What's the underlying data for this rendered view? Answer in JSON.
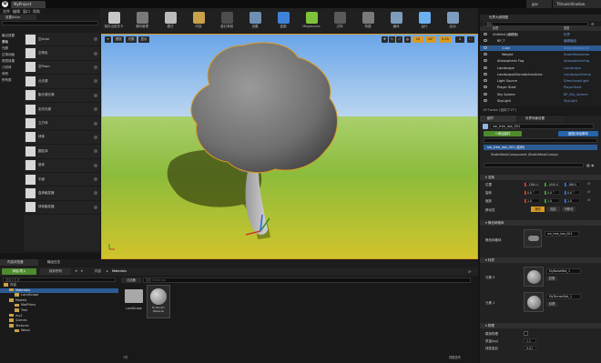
{
  "window": {
    "tab": "MyProject",
    "right_tabs": [
      "gac",
      "TitlewinShadow"
    ]
  },
  "menu": [
    "文件",
    "编辑",
    "窗口",
    "帮助"
  ],
  "toolbar": {
    "items": [
      {
        "label": "保存当前关卡",
        "color": "#c8c8c8",
        "icon": "save-icon"
      },
      {
        "label": "源码管理",
        "color": "#7a7a7a",
        "icon": "source-control-icon"
      },
      {
        "label": "模式",
        "color": "#bbbbbb",
        "icon": "modes-icon"
      },
      {
        "label": "内容",
        "color": "#c9a24a",
        "icon": "content-icon"
      },
      {
        "label": "虚幻商城",
        "color": "#4d4d4d",
        "icon": "marketplace-icon"
      },
      {
        "label": "设置",
        "color": "#6f8fb5",
        "icon": "settings-icon"
      },
      {
        "label": "蓝图",
        "color": "#3e83d9",
        "icon": "blueprints-icon"
      },
      {
        "label": "Megascans",
        "color": "#7ec43a",
        "icon": "megascans-icon"
      },
      {
        "label": "过场",
        "color": "#5a5a5a",
        "icon": "cinematics-icon"
      },
      {
        "label": "构建",
        "color": "#7a7a7a",
        "icon": "build-icon"
      },
      {
        "label": "编译",
        "color": "#7e9cbd",
        "icon": "compile-icon"
      },
      {
        "label": "运行",
        "color": "#6bb0f0",
        "icon": "play-icon"
      },
      {
        "label": "启动",
        "color": "#7e9cbd",
        "icon": "launch-icon"
      }
    ]
  },
  "modes_panel": {
    "tab": "放置Actor",
    "search_placeholder": "搜索类",
    "categories": [
      "最近放置",
      "基础",
      "光照",
      "过场动画",
      "视觉效果",
      "几何体",
      "体积",
      "所有类"
    ],
    "items": [
      "空Actor",
      "空角色",
      "空Pawn",
      "点光源",
      "聚光源光源",
      "定向光源",
      "立方体",
      "球体",
      "圆柱体",
      "锥体",
      "平面",
      "盒体触发器",
      "球体触发器"
    ]
  },
  "viewport": {
    "left_buttons": [
      "透视",
      "光照",
      "显示"
    ],
    "right_values": [
      "10",
      "10°",
      "0.25",
      "4"
    ]
  },
  "outliner": {
    "tab": "世界大纲视图",
    "search_placeholder": "搜索...",
    "column_label": "标签",
    "column_type": "类型",
    "rows": [
      {
        "name": "Untitled (编辑器)",
        "type": "世界",
        "indent": 0
      },
      {
        "name": "BP_T",
        "type": "编辑器组",
        "indent": 1
      },
      {
        "name": "Cube",
        "type": "StaticMeshActor",
        "indent": 2
      },
      {
        "name": "Weight",
        "type": "StaticMeshActor",
        "indent": 2
      },
      {
        "name": "Atmospheric Fog",
        "type": "AtmosphericFog",
        "indent": 1
      },
      {
        "name": "Landscape",
        "type": "Landscape",
        "indent": 1
      },
      {
        "name": "LandscapeGizmoActiveActor",
        "type": "LandscapeGizmo",
        "indent": 1
      },
      {
        "name": "Light Source",
        "type": "DirectionalLight",
        "indent": 1
      },
      {
        "name": "Player Start",
        "type": "PlayerStart",
        "indent": 1
      },
      {
        "name": "Sky Sphere",
        "type": "BP_Sky_Sphere",
        "indent": 1
      },
      {
        "name": "SkyLight",
        "type": "SkyLight",
        "indent": 1
      }
    ],
    "footer": "19个actor (选择了1个)"
  },
  "details": {
    "tabs": [
      "细节",
      "世界场景设置"
    ],
    "add_component": "+添加组件",
    "blueprint_button": "蓝图/添加脚本",
    "actor_name": "sm_tree_low_001",
    "instance_label": "sm_tree_low_001 (实例)",
    "component": "StaticMeshComponent (StaticMeshCompo",
    "sections": {
      "transform": "变换",
      "static_mesh": "静态网格体",
      "materials": "材质",
      "physics": "物理"
    },
    "transform": {
      "rows": [
        {
          "label": "位置",
          "x": "-1380.0",
          "y": "-1000.0",
          "z": "-168.0"
        },
        {
          "label": "旋转",
          "x": "0.0 °",
          "y": "0.0 °",
          "z": "0.0 °"
        },
        {
          "label": "缩放",
          "x": "1.0",
          "y": "1.0",
          "z": "1.0"
        }
      ],
      "mobility_label": "移动性",
      "mobility": [
        "静态",
        "固定",
        "可移动"
      ]
    },
    "static_mesh_label": "静态网格体",
    "mesh_value": "sm_tree_low_001",
    "material_rows": [
      {
        "label": "元素 0",
        "value": "MyNoiseMat_1",
        "tag": "纹理"
      },
      {
        "label": "元素 1",
        "value": "MyTerrainMat_1",
        "tag": "纹理"
      }
    ],
    "physics": {
      "simulate_label": "模拟物理",
      "mass_label": "质量(kg)",
      "damping_label": "线性阻尼",
      "mass_value": "0.0",
      "damping_value": "0.01"
    }
  },
  "content_browser": {
    "tabs": [
      "内容浏览器",
      "输出日志"
    ],
    "add_new": "添加/导入",
    "save_all": "保存所有",
    "path": [
      "内容",
      "Materials"
    ],
    "filter_label": "过滤器",
    "search_placeholder": "搜索 Materials",
    "tree_search": "搜索文件夹",
    "tree": [
      {
        "name": "内容",
        "indent": 0
      },
      {
        "name": "Materials",
        "indent": 1
      },
      {
        "name": "LandScape",
        "indent": 2
      },
      {
        "name": "Models",
        "indent": 1
      },
      {
        "name": "MatPrims",
        "indent": 2
      },
      {
        "name": "Tree",
        "indent": 2
      },
      {
        "name": "my1",
        "indent": 1
      },
      {
        "name": "Scenes",
        "indent": 1
      },
      {
        "name": "Textures",
        "indent": 1
      },
      {
        "name": "Wood",
        "indent": 2
      }
    ],
    "assets": [
      {
        "name": "LandScape",
        "kind": "folder"
      },
      {
        "name": "M_Terrain\nMaterial",
        "kind": "material"
      }
    ],
    "footer": "2项",
    "view_options": "视图选项"
  }
}
